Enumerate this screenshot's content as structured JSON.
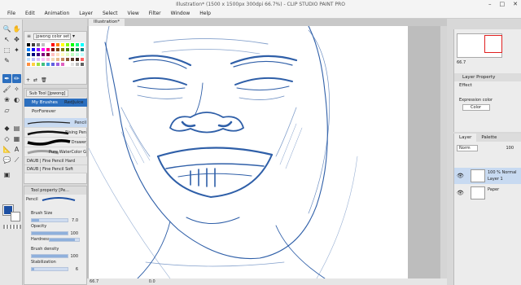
{
  "window": {
    "title": "Illustration* (1500 x 1500px 300dpi 66.7%) - CLIP STUDIO PAINT PRO",
    "controls": [
      "–",
      "□",
      "✕"
    ]
  },
  "menu": [
    "File",
    "Edit",
    "Animation",
    "Layer",
    "Select",
    "View",
    "Filter",
    "Window",
    "Help"
  ],
  "colors": {
    "accent": "#2c6fbf",
    "selection": "#c8daf1",
    "main_color": "#1c4fa2",
    "sub_color": "#ffffff",
    "navigator_frame": "#e02020",
    "stroke": "#2f5fa8"
  },
  "color_set": {
    "selected": "jpwong color set",
    "swatches": [
      "#000000",
      "#404040",
      "#808080",
      "#c0c0c0",
      "#ffffff",
      "#ff0000",
      "#ff8000",
      "#ffff00",
      "#80ff00",
      "#00ff00",
      "#00ff80",
      "#00ffff",
      "#0080ff",
      "#0000ff",
      "#8000ff",
      "#ff00ff",
      "#ff0080",
      "#800000",
      "#804000",
      "#808000",
      "#408000",
      "#008000",
      "#008040",
      "#008080",
      "#004080",
      "#000080",
      "#400080",
      "#800080",
      "#800040",
      "#ffc0c0",
      "#ffe0c0",
      "#ffffc0",
      "#e0ffc0",
      "#c0ffc0",
      "#c0ffe0",
      "#c0ffff",
      "#c0e0ff",
      "#c0c0ff",
      "#e0c0ff",
      "#ffc0ff",
      "#ffc0e0",
      "#f4d7b4",
      "#e8b98c",
      "#c48a5c",
      "#8c5a3a",
      "#5a3a2a",
      "#3a2418",
      "#ff6060",
      "#ff9040",
      "#ffd040",
      "#a0e040",
      "#40c080",
      "#40a0e0",
      "#6060e0",
      "#a060e0",
      "#e060c0",
      "#ffffff",
      "#e0e0e0",
      "#b0b0b0",
      "#606060"
    ]
  },
  "sub_tool": {
    "header": "Sub Tool [Jpwong]",
    "groups": [
      "My Brushes",
      "RedJuice",
      "PorForever"
    ],
    "brushes": [
      {
        "name": "Pencil",
        "selected": true
      },
      {
        "name": "Rising Pen",
        "selected": false
      },
      {
        "name": "Drawer",
        "selected": false
      },
      {
        "name": "Pure WaterColor G",
        "selected": false
      }
    ],
    "extra_items": [
      "DAUB | Fine Pencil Hard",
      "DAUB | Fine Pencil Soft"
    ]
  },
  "tool_property": {
    "header": "Tool property [Pe...",
    "brush_name": "Pencil",
    "props": [
      {
        "label": "Brush Size",
        "value": "7.0",
        "level": 0.2
      },
      {
        "label": "Opacity",
        "value": "100",
        "level": 1.0
      },
      {
        "label": "Hardness",
        "value": "",
        "level": 0.85
      },
      {
        "label": "Brush density",
        "value": "100",
        "level": 1.0
      },
      {
        "label": "Stabilization",
        "value": "6",
        "level": 0.06
      }
    ]
  },
  "canvas": {
    "tab_label": "Illustration*",
    "zoom": "66.7",
    "status_value": "0.0"
  },
  "navigator": {
    "zoom": "66.7"
  },
  "layer_property": {
    "header": "Layer Property",
    "effect_label": "Effect",
    "expression_label": "Expression color",
    "expression_value": "Color"
  },
  "layer_panel": {
    "tabs": [
      "Layer",
      "Palette"
    ],
    "blend_mode": "Norm",
    "opacity": "100",
    "layers": [
      {
        "line1": "100 % Normal",
        "line2": "Layer 1",
        "selected": true
      },
      {
        "line1": "Paper",
        "line2": "",
        "selected": false
      }
    ]
  }
}
